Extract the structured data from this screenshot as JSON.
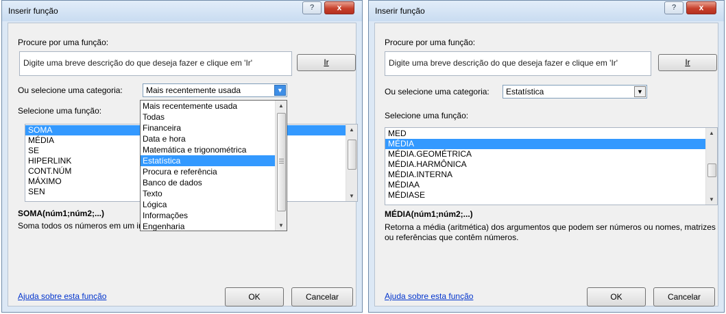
{
  "left": {
    "title": "Inserir função",
    "help_glyph": "?",
    "close_glyph": "x",
    "search_label": "Procure por uma função:",
    "search_placeholder": "Digite uma breve descrição do que deseja fazer e clique em 'Ir'",
    "go_label": "Ir",
    "category_label": "Ou selecione uma categoria:",
    "category_value": "Mais recentemente usada",
    "functions_label": "Selecione uma função:",
    "functions": [
      "SOMA",
      "MÉDIA",
      "SE",
      "HIPERLINK",
      "CONT.NÚM",
      "MÁXIMO",
      "SEN"
    ],
    "selected_function": "SOMA",
    "signature": "SOMA(núm1;núm2;...)",
    "description": "Soma todos os números em um intervalo de células.",
    "help_link": "Ajuda sobre esta função",
    "ok_label": "OK",
    "cancel_label": "Cancelar",
    "dropdown_open": true,
    "categories": [
      "Mais recentemente usada",
      "Todas",
      "Financeira",
      "Data e hora",
      "Matemática e trigonométrica",
      "Estatística",
      "Procura e referência",
      "Banco de dados",
      "Texto",
      "Lógica",
      "Informações",
      "Engenharia"
    ],
    "highlighted_category": "Estatística"
  },
  "right": {
    "title": "Inserir função",
    "help_glyph": "?",
    "close_glyph": "x",
    "search_label": "Procure por uma função:",
    "search_placeholder": "Digite uma breve descrição do que deseja fazer e clique em 'Ir'",
    "go_label": "Ir",
    "category_label": "Ou selecione uma categoria:",
    "category_value": "Estatística",
    "functions_label": "Selecione uma função:",
    "functions": [
      "MED",
      "MÉDIA",
      "MÉDIA.GEOMÉTRICA",
      "MÉDIA.HARMÔNICA",
      "MÉDIA.INTERNA",
      "MÉDIAA",
      "MÉDIASE"
    ],
    "selected_function": "MÉDIA",
    "signature": "MÉDIA(núm1;núm2;...)",
    "description": "Retorna a média (aritmética) dos argumentos que podem ser números ou nomes, matrizes ou referências que contêm números.",
    "help_link": "Ajuda sobre esta função",
    "ok_label": "OK",
    "cancel_label": "Cancelar"
  },
  "icons": {
    "dropdown_arrow": "▼",
    "scroll_up": "▲",
    "scroll_down": "▼"
  }
}
